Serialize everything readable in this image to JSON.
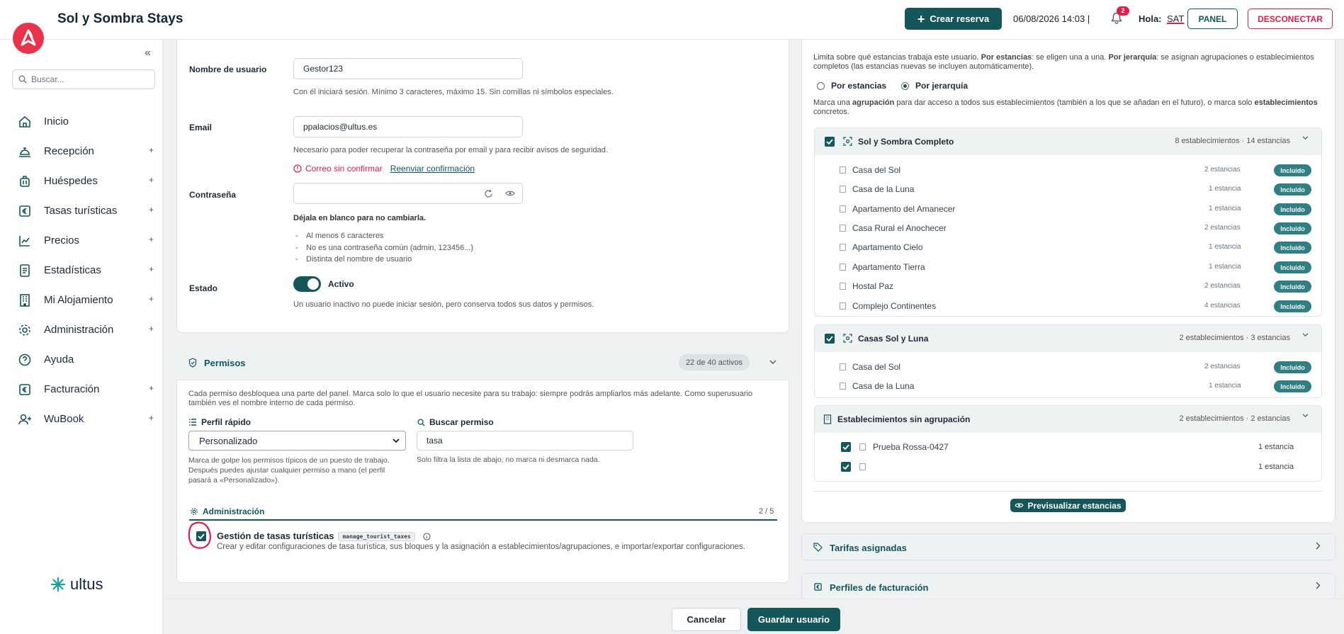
{
  "app": {
    "title": "Sol y Sombra Stays"
  },
  "topbar": {
    "create_label": "Crear reserva",
    "datetime": "06/08/2026 14:03 |",
    "notif_count": "2",
    "greeting": "Hola:",
    "user": "SAT",
    "panel_label": "PANEL",
    "logout_label": "DESCONECTAR"
  },
  "sidebar": {
    "search_placeholder": "Buscar...",
    "items": [
      {
        "label": "Inicio",
        "icon": "home-icon",
        "expandable": false
      },
      {
        "label": "Recepción",
        "icon": "reception-bell-icon",
        "expandable": true
      },
      {
        "label": "Huéspedes",
        "icon": "luggage-icon",
        "expandable": true
      },
      {
        "label": "Tasas turísticas",
        "icon": "euro-tax-icon",
        "expandable": true
      },
      {
        "label": "Precios",
        "icon": "trend-chart-icon",
        "expandable": true
      },
      {
        "label": "Estadísticas",
        "icon": "document-stats-icon",
        "expandable": true
      },
      {
        "label": "Mi Alojamiento",
        "icon": "building-icon",
        "expandable": true
      },
      {
        "label": "Administración",
        "icon": "gear-icon",
        "expandable": true
      },
      {
        "label": "Ayuda",
        "icon": "help-icon",
        "expandable": false
      },
      {
        "label": "Facturación",
        "icon": "invoice-euro-icon",
        "expandable": true
      },
      {
        "label": "WuBook",
        "icon": "user-link-icon",
        "expandable": true
      }
    ],
    "plus": "+",
    "footer_logo": "ultus"
  },
  "form": {
    "username_label": "Nombre de usuario",
    "username_value": "Gestor123",
    "username_hint": "Con él iniciará sesión. Mínimo 3 caracteres, máximo 15. Sin comillas ni símbolos especiales.",
    "email_label": "Email",
    "email_value": "ppalacios@ultus.es",
    "email_hint": "Necesario para poder recuperar la contraseña por email y para recibir avisos de seguridad.",
    "email_error": "Correo sin confirmar",
    "email_resend": "Reenviar confirmación",
    "password_label": "Contraseña",
    "password_value": "",
    "password_hint": "Déjala en blanco para no cambiarla.",
    "password_rules": [
      "Al menos 6 caracteres",
      "No es una contraseña común (admin, 123456...)",
      "Distinta del nombre de usuario"
    ],
    "rule_dash": "-",
    "status_label": "Estado",
    "status_value": "Activo",
    "status_hint": "Un usuario inactivo no puede iniciar sesión, pero conserva todos sus datos y permisos."
  },
  "permissions": {
    "title": "Permisos",
    "count": "22 de 40 activos",
    "description": "Cada permiso desbloquea una parte del panel. Marca solo lo que el usuario necesite para su trabajo: siempre podrás ampliarlos más adelante. Como superusuario también ves el nombre interno de cada permiso.",
    "profile_label": "Perfil rápido",
    "profile_value": "Personalizado",
    "profile_hint": "Marca de golpe los permisos típicos de un puesto de trabajo. Después puedes ajustar cualquier permiso a mano (el perfil pasará a «Personalizado»).",
    "search_label": "Buscar permiso",
    "search_value": "tasa",
    "search_hint": "Solo filtra la lista de abajo; no marca ni desmarca nada.",
    "section_title": "Administración",
    "section_count": "2 / 5",
    "item": {
      "name": "Gestión de tasas turísticas",
      "code": "manage_tourist_taxes",
      "checked": true,
      "description": "Crear y editar configuraciones de tasa turística, sus bloques y la asignación a establecimientos/agrupaciones, e importar/exportar configuraciones."
    }
  },
  "scope": {
    "intro_a": "Limita sobre qué estancias trabaja este usuario. ",
    "intro_b": "Por estancias",
    "intro_c": ": se eligen una a una. ",
    "intro_d": "Por jerarquía",
    "intro_e": ": se asignan agrupaciones o establecimientos completos (las estancias nuevas se incluyen automáticamente).",
    "option_a": "Por estancias",
    "option_b": "Por jerarquía",
    "selected": "Por jerarquía",
    "note_a": "Marca una ",
    "note_b": "agrupación",
    "note_c": " para dar acceso a todos sus establecimientos (también a los que se añadan en el futuro), o marca solo ",
    "note_d": "establecimientos",
    "note_e": " concretos.",
    "included_label": "Incluido",
    "groups": [
      {
        "name": "Sol y Sombra Completo",
        "meta": "8 establecimientos · 14 estancias",
        "properties": [
          {
            "name": "Casa del Sol",
            "count": "2 estancias"
          },
          {
            "name": "Casa de la Luna",
            "count": "1 estancia"
          },
          {
            "name": "Apartamento del Amanecer",
            "count": "1 estancia"
          },
          {
            "name": "Casa Rural el Anochecer",
            "count": "2 estancias"
          },
          {
            "name": "Apartamento Cielo",
            "count": "1 estancia"
          },
          {
            "name": "Apartamento Tierra",
            "count": "1 estancia"
          },
          {
            "name": "Hostal Paz",
            "count": "2 estancias"
          },
          {
            "name": "Complejo Continentes",
            "count": "4 estancias"
          }
        ]
      },
      {
        "name": "Casas Sol y Luna",
        "meta": "2 establecimientos · 3 estancias",
        "properties": [
          {
            "name": "Casa del Sol",
            "count": "2 estancias"
          },
          {
            "name": "Casa de la Luna",
            "count": "1 estancia"
          }
        ]
      }
    ],
    "ungrouped": {
      "title": "Establecimientos sin agrupación",
      "meta": "2 establecimientos · 2 estancias",
      "properties": [
        {
          "name": "Prueba Rossa-0427",
          "count": "1 estancia"
        },
        {
          "name": "",
          "count": "1 estancia"
        }
      ]
    },
    "preview_label": "Previsualizar estancias"
  },
  "accordions": {
    "tarifas": "Tarifas asignadas",
    "perfiles": "Perfiles de facturación"
  },
  "footer": {
    "cancel": "Cancelar",
    "save": "Guardar usuario"
  },
  "colors": {
    "accent": "#14565a",
    "danger": "#e11d48",
    "brand": "#e8334b",
    "badge": "#2f7f85"
  }
}
